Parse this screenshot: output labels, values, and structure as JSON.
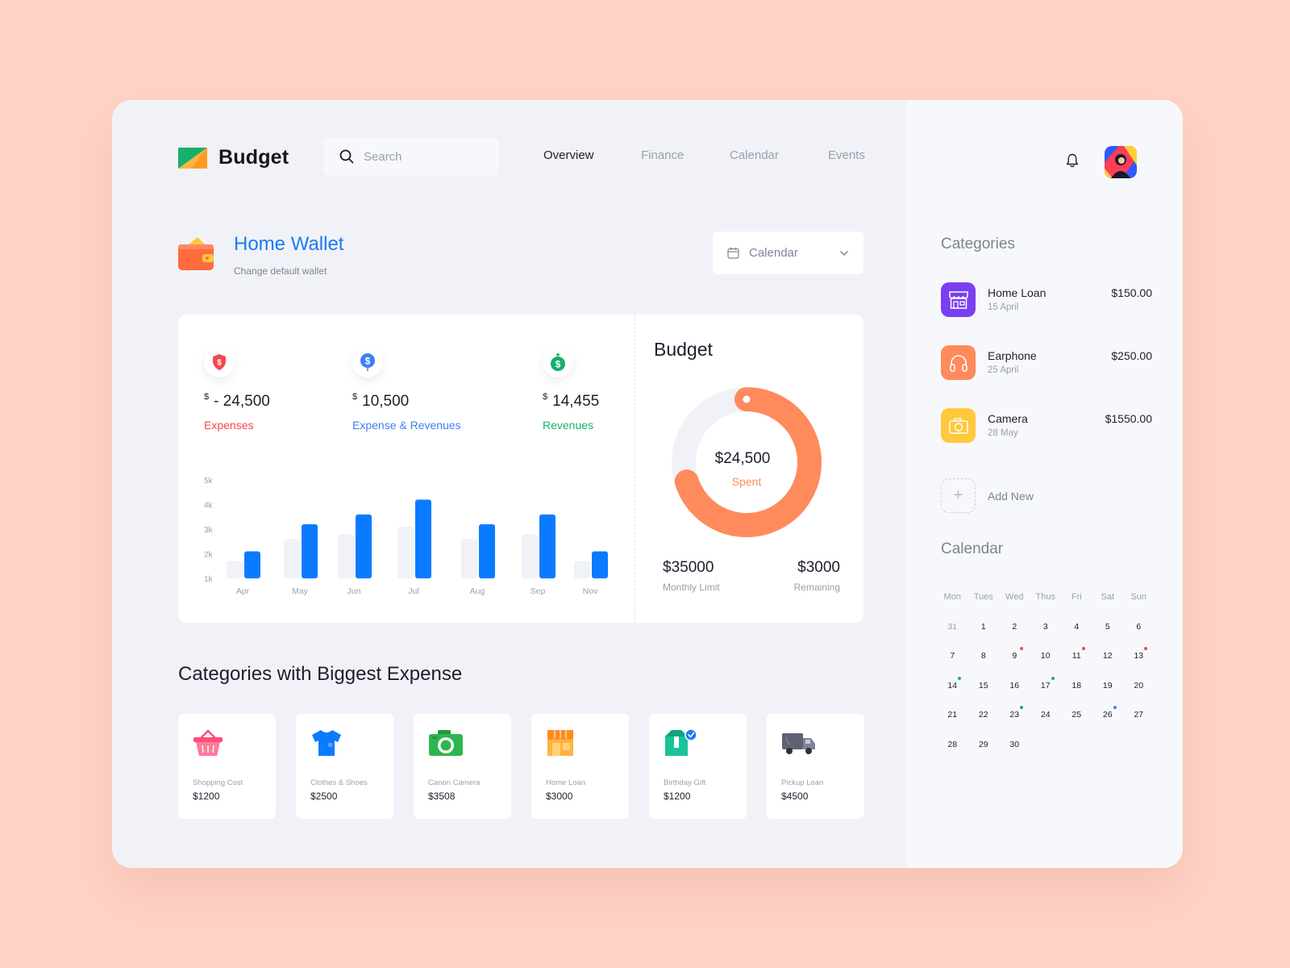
{
  "app": {
    "name": "Budget",
    "accent": "#1a7cf5"
  },
  "search": {
    "placeholder": "Search"
  },
  "nav": [
    {
      "label": "Overview",
      "active": true
    },
    {
      "label": "Finance",
      "active": false
    },
    {
      "label": "Calendar",
      "active": false
    },
    {
      "label": "Events",
      "active": false
    }
  ],
  "header": {
    "notification_icon": "bell-icon",
    "avatar_icon": "user-avatar"
  },
  "wallet": {
    "title": "Home Wallet",
    "subtitle": "Change default wallet",
    "icon": "wallet-icon"
  },
  "calendar_dropdown": {
    "label": "Calendar"
  },
  "stats": [
    {
      "currency": "$",
      "value": "- 24,500",
      "label": "Expenses",
      "color": "#f4474f",
      "icon": "shield-dollar-icon"
    },
    {
      "currency": "$",
      "value": "10,500",
      "label": "Expense & Revenues",
      "color": "#3f7ff5",
      "icon": "dollar-coin-icon"
    },
    {
      "currency": "$",
      "value": "14,455",
      "label": "Revenues",
      "color": "#16b06a",
      "icon": "dollar-up-icon"
    }
  ],
  "chart_data": {
    "type": "bar",
    "categories": [
      "Apr",
      "May",
      "Jun",
      "Jul",
      "Aug",
      "Sep",
      "Nov"
    ],
    "y_tick_labels": [
      "1k",
      "2k",
      "3k",
      "4k",
      "5k"
    ],
    "ylim": [
      1,
      5
    ],
    "grid": false,
    "series": [
      {
        "values": [
          1.7,
          2.6,
          2.8,
          3.1,
          2.6,
          2.8,
          1.7
        ],
        "color": "#f1f2f7"
      },
      {
        "values": [
          2.1,
          3.2,
          3.6,
          4.2,
          3.2,
          3.6,
          2.1
        ],
        "color": "#0a7bff"
      }
    ]
  },
  "budget": {
    "title": "Budget",
    "spent_value": "$24,500",
    "spent_label": "Spent",
    "spent_fraction": 0.7,
    "ring_color": "#ff8a5c",
    "limit_value": "$35000",
    "limit_label": "Monthly Limit",
    "remaining_value": "$3000",
    "remaining_label": "Remaining"
  },
  "biggest_expense": {
    "title": "Categories with Biggest Expense",
    "items": [
      {
        "name": "Shopping Cost",
        "amount": "$1200",
        "icon": "basket-icon"
      },
      {
        "name": "Clothes & Shoes",
        "amount": "$2500",
        "icon": "tshirt-icon"
      },
      {
        "name": "Canon Camera",
        "amount": "$3508",
        "icon": "camera-icon"
      },
      {
        "name": "Home Loan",
        "amount": "$3000",
        "icon": "store-icon"
      },
      {
        "name": "Birthday Gift",
        "amount": "$1200",
        "icon": "gift-box-icon"
      },
      {
        "name": "Pickup Loan",
        "amount": "$4500",
        "icon": "truck-icon"
      }
    ]
  },
  "categories": {
    "title": "Categories",
    "items": [
      {
        "name": "Home Loan",
        "date": "15 April",
        "amount": "$150.00",
        "color": "#7b3ff2",
        "icon": "store-icon"
      },
      {
        "name": "Earphone",
        "date": "25 April",
        "amount": "$250.00",
        "color": "#ff8a5c",
        "icon": "headphones-icon"
      },
      {
        "name": "Camera",
        "date": "28 May",
        "amount": "$1550.00",
        "color": "#ffc83d",
        "icon": "camera-icon"
      }
    ],
    "add_label": "Add New"
  },
  "calendar": {
    "title": "Calendar",
    "weekdays": [
      "Mon",
      "Tues",
      "Wed",
      "Thus",
      "Fri",
      "Sat",
      "Sun"
    ],
    "weeks": [
      [
        "31",
        "1",
        "2",
        "3",
        "4",
        "5",
        "6"
      ],
      [
        "7",
        "8",
        "9",
        "10",
        "11",
        "12",
        "13"
      ],
      [
        "14",
        "15",
        "16",
        "17",
        "18",
        "19",
        "20"
      ],
      [
        "21",
        "22",
        "23",
        "24",
        "25",
        "26",
        "27"
      ],
      [
        "28",
        "29",
        "30",
        "",
        "",
        "",
        ""
      ]
    ],
    "muted_days": [
      "31"
    ],
    "event_dots": [
      {
        "day": "9",
        "color": "#f4474f"
      },
      {
        "day": "11",
        "color": "#f4474f"
      },
      {
        "day": "13",
        "color": "#f4474f"
      },
      {
        "day": "14",
        "color": "#16b06a"
      },
      {
        "day": "17",
        "color": "#16b06a"
      },
      {
        "day": "23",
        "color": "#16b06a"
      },
      {
        "day": "26",
        "color": "#3f7ff5"
      }
    ]
  }
}
